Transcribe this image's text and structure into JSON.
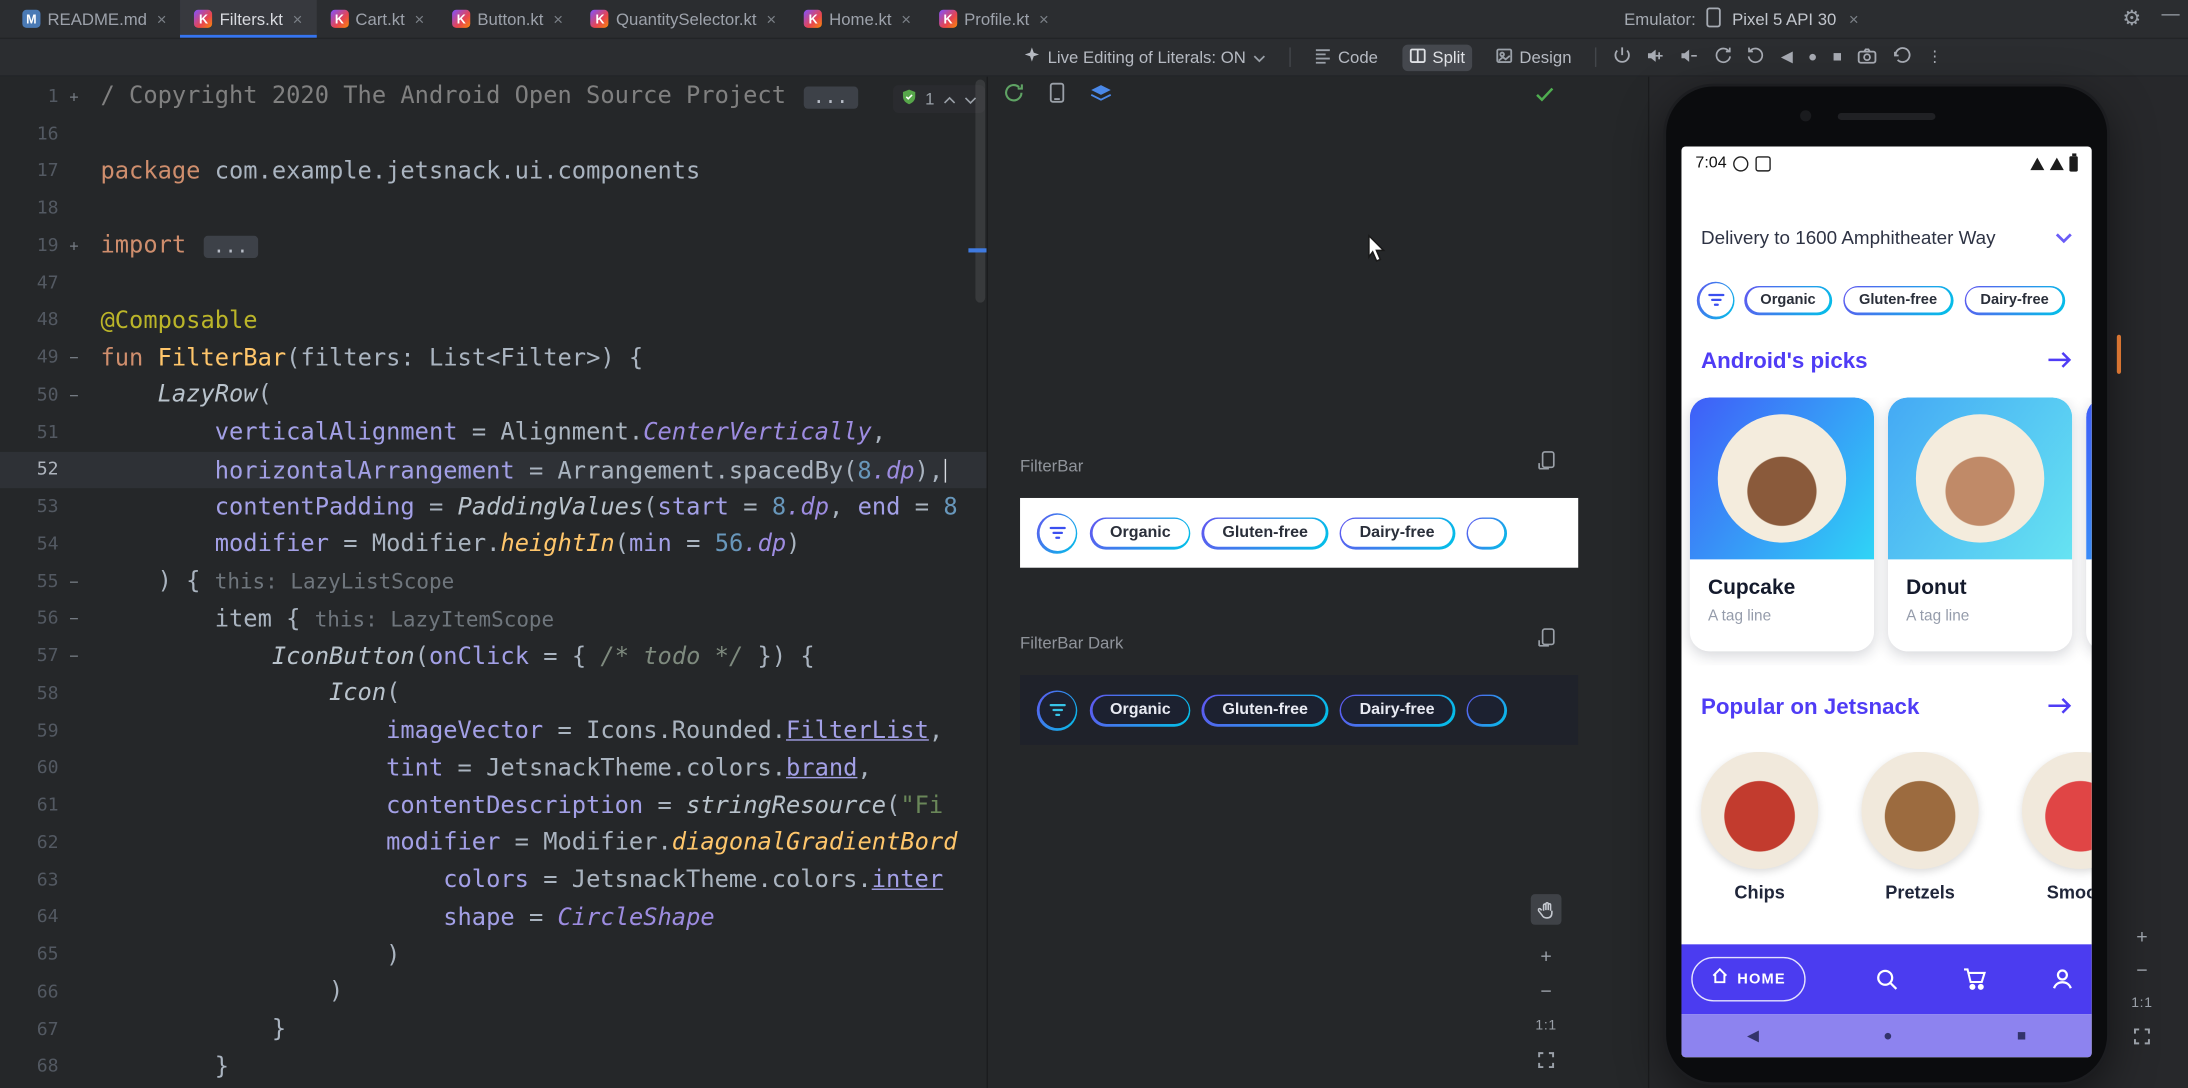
{
  "icons": {
    "gear": "⚙",
    "minimize": "—",
    "close": "×",
    "more": "⋮",
    "nav_back": "◀",
    "nav_home": "●",
    "nav_recents": "■",
    "plus": "+",
    "minus": "−"
  },
  "window": {
    "tabs": [
      {
        "label": "README.md",
        "active": false
      },
      {
        "label": "Filters.kt",
        "active": true
      },
      {
        "label": "Cart.kt",
        "active": false
      },
      {
        "label": "Button.kt",
        "active": false
      },
      {
        "label": "QuantitySelector.kt",
        "active": false
      },
      {
        "label": "Home.kt",
        "active": false
      },
      {
        "label": "Profile.kt",
        "active": false
      }
    ],
    "emulator_label": "Emulator:",
    "emulator_device": "Pixel 5 API 30"
  },
  "toolbar": {
    "live_editing": "Live Editing of Literals: ON",
    "code": "Code",
    "split": "Split",
    "design": "Design"
  },
  "editor": {
    "problems_count": "1",
    "lines": [
      {
        "n": "1",
        "fold": "+",
        "seg": [
          [
            "cm",
            "/ Copyright 2020 The Android Open Source Project "
          ],
          [
            "foldbox",
            "..."
          ]
        ]
      },
      {
        "n": "16",
        "seg": []
      },
      {
        "n": "17",
        "seg": [
          [
            "kw",
            "package "
          ],
          [
            "pl",
            "com.example.jetsnack.ui.components"
          ]
        ]
      },
      {
        "n": "18",
        "seg": []
      },
      {
        "n": "19",
        "fold": "+",
        "seg": [
          [
            "kw",
            "import "
          ],
          [
            "foldbox",
            "..."
          ]
        ]
      },
      {
        "n": "47",
        "seg": []
      },
      {
        "n": "48",
        "seg": [
          [
            "ann",
            "@Composable"
          ]
        ]
      },
      {
        "n": "49",
        "fold": "-",
        "seg": [
          [
            "kw",
            "fun "
          ],
          [
            "fn",
            "FilterBar"
          ],
          [
            "pl",
            "(filters: List<Filter>) {"
          ]
        ]
      },
      {
        "n": "50",
        "fold": "-",
        "seg": [
          [
            "pl",
            "    "
          ],
          [
            "fnit",
            "LazyRow"
          ],
          [
            "pl",
            "("
          ]
        ]
      },
      {
        "n": "51",
        "seg": [
          [
            "pl",
            "        "
          ],
          [
            "param",
            "verticalAlignment"
          ],
          [
            "pl",
            " = Alignment."
          ],
          [
            "prop",
            "CenterVertically"
          ],
          [
            "pl",
            ","
          ]
        ]
      },
      {
        "n": "52",
        "cur": true,
        "caret": true,
        "seg": [
          [
            "pl",
            "        "
          ],
          [
            "param",
            "horizontalArrangement"
          ],
          [
            "pl",
            " = Arrangement.spacedBy("
          ],
          [
            "num",
            "8"
          ],
          [
            "prop",
            ".dp"
          ],
          [
            "pl",
            "),"
          ]
        ]
      },
      {
        "n": "53",
        "seg": [
          [
            "pl",
            "        "
          ],
          [
            "param",
            "contentPadding"
          ],
          [
            "pl",
            " = "
          ],
          [
            "fnit",
            "PaddingValues"
          ],
          [
            "pl",
            "("
          ],
          [
            "param",
            "start"
          ],
          [
            "pl",
            " = "
          ],
          [
            "num",
            "8"
          ],
          [
            "prop",
            ".dp"
          ],
          [
            "pl",
            ", "
          ],
          [
            "param",
            "end"
          ],
          [
            "pl",
            " = "
          ],
          [
            "num",
            "8"
          ]
        ]
      },
      {
        "n": "54",
        "seg": [
          [
            "pl",
            "        "
          ],
          [
            "param",
            "modifier"
          ],
          [
            "pl",
            " = Modifier."
          ],
          [
            "ext",
            "heightIn"
          ],
          [
            "pl",
            "("
          ],
          [
            "param",
            "min"
          ],
          [
            "pl",
            " = "
          ],
          [
            "num",
            "56"
          ],
          [
            "prop",
            ".dp"
          ],
          [
            "pl",
            ")"
          ]
        ]
      },
      {
        "n": "55",
        "fold": "-",
        "seg": [
          [
            "pl",
            "    ) { "
          ],
          [
            "hint",
            "this: LazyListScope"
          ]
        ]
      },
      {
        "n": "56",
        "fold": "-",
        "seg": [
          [
            "pl",
            "        item { "
          ],
          [
            "hint",
            "this: LazyItemScope"
          ]
        ]
      },
      {
        "n": "57",
        "fold": "-",
        "seg": [
          [
            "pl",
            "            "
          ],
          [
            "fnit",
            "IconButton"
          ],
          [
            "pl",
            "("
          ],
          [
            "param",
            "onClick"
          ],
          [
            "pl",
            " = { "
          ],
          [
            "cmi",
            "/* todo */"
          ],
          [
            "pl",
            " }) {"
          ]
        ]
      },
      {
        "n": "58",
        "seg": [
          [
            "pl",
            "                "
          ],
          [
            "fnit",
            "Icon"
          ],
          [
            "pl",
            "("
          ]
        ]
      },
      {
        "n": "59",
        "seg": [
          [
            "pl",
            "                    "
          ],
          [
            "param",
            "imageVector"
          ],
          [
            "pl",
            " = Icons.Rounded."
          ],
          [
            "underl",
            "FilterList"
          ],
          [
            "pl",
            ","
          ]
        ]
      },
      {
        "n": "60",
        "seg": [
          [
            "pl",
            "                    "
          ],
          [
            "param",
            "tint"
          ],
          [
            "pl",
            " = JetsnackTheme.colors."
          ],
          [
            "underl",
            "brand"
          ],
          [
            "pl",
            ","
          ]
        ]
      },
      {
        "n": "61",
        "seg": [
          [
            "pl",
            "                    "
          ],
          [
            "param",
            "contentDescription"
          ],
          [
            "pl",
            " = "
          ],
          [
            "fnit",
            "stringResource"
          ],
          [
            "pl",
            "("
          ],
          [
            "str",
            "\"Fi"
          ]
        ]
      },
      {
        "n": "62",
        "seg": [
          [
            "pl",
            "                    "
          ],
          [
            "param",
            "modifier"
          ],
          [
            "pl",
            " = Modifier."
          ],
          [
            "ext",
            "diagonalGradientBord"
          ]
        ]
      },
      {
        "n": "63",
        "seg": [
          [
            "pl",
            "                        "
          ],
          [
            "param",
            "colors"
          ],
          [
            "pl",
            " = JetsnackTheme.colors."
          ],
          [
            "underl",
            "inter"
          ]
        ]
      },
      {
        "n": "64",
        "seg": [
          [
            "pl",
            "                        "
          ],
          [
            "param",
            "shape"
          ],
          [
            "pl",
            " = "
          ],
          [
            "prop",
            "CircleShape"
          ]
        ]
      },
      {
        "n": "65",
        "seg": [
          [
            "pl",
            "                    )"
          ]
        ]
      },
      {
        "n": "66",
        "seg": [
          [
            "pl",
            "                )"
          ]
        ]
      },
      {
        "n": "67",
        "seg": [
          [
            "pl",
            "            }"
          ]
        ]
      },
      {
        "n": "68",
        "seg": [
          [
            "pl",
            "        }"
          ]
        ]
      }
    ]
  },
  "preview": {
    "panels": [
      {
        "title": "FilterBar",
        "theme": "light",
        "chips": [
          "Organic",
          "Gluten-free",
          "Dairy-free"
        ]
      },
      {
        "title": "FilterBar Dark",
        "theme": "dark",
        "chips": [
          "Organic",
          "Gluten-free",
          "Dairy-free"
        ]
      }
    ],
    "zoom_label": "1:1"
  },
  "emulator": {
    "time": "7:04",
    "delivery": "Delivery to 1600 Amphitheater Way",
    "filter_chips": [
      "Organic",
      "Gluten-free",
      "Dairy-free"
    ],
    "sections": [
      {
        "title": "Android's picks"
      },
      {
        "title": "Popular on Jetsnack"
      }
    ],
    "picks": [
      {
        "name": "Cupcake",
        "tag": "A tag line",
        "accent": "#8a5a3b",
        "gradient": [
          "#3f5df8",
          "#2fd4f6"
        ]
      },
      {
        "name": "Donut",
        "tag": "A tag line",
        "accent": "#c08a68",
        "gradient": [
          "#44a9f4",
          "#66e3f2"
        ]
      }
    ],
    "popular": [
      {
        "name": "Chips",
        "accent": "#c23b2e"
      },
      {
        "name": "Pretzels",
        "accent": "#9c6b3f"
      },
      {
        "name": "Smooth",
        "accent": "#e04545"
      }
    ],
    "nav_home": "HOME",
    "zoom_label": "1:1"
  },
  "colors": {
    "brand": "#4f3cf5",
    "brand_light": "#8d83ef",
    "chip_gradient_start": "#6156f0",
    "chip_gradient_end": "#00c3e8"
  }
}
